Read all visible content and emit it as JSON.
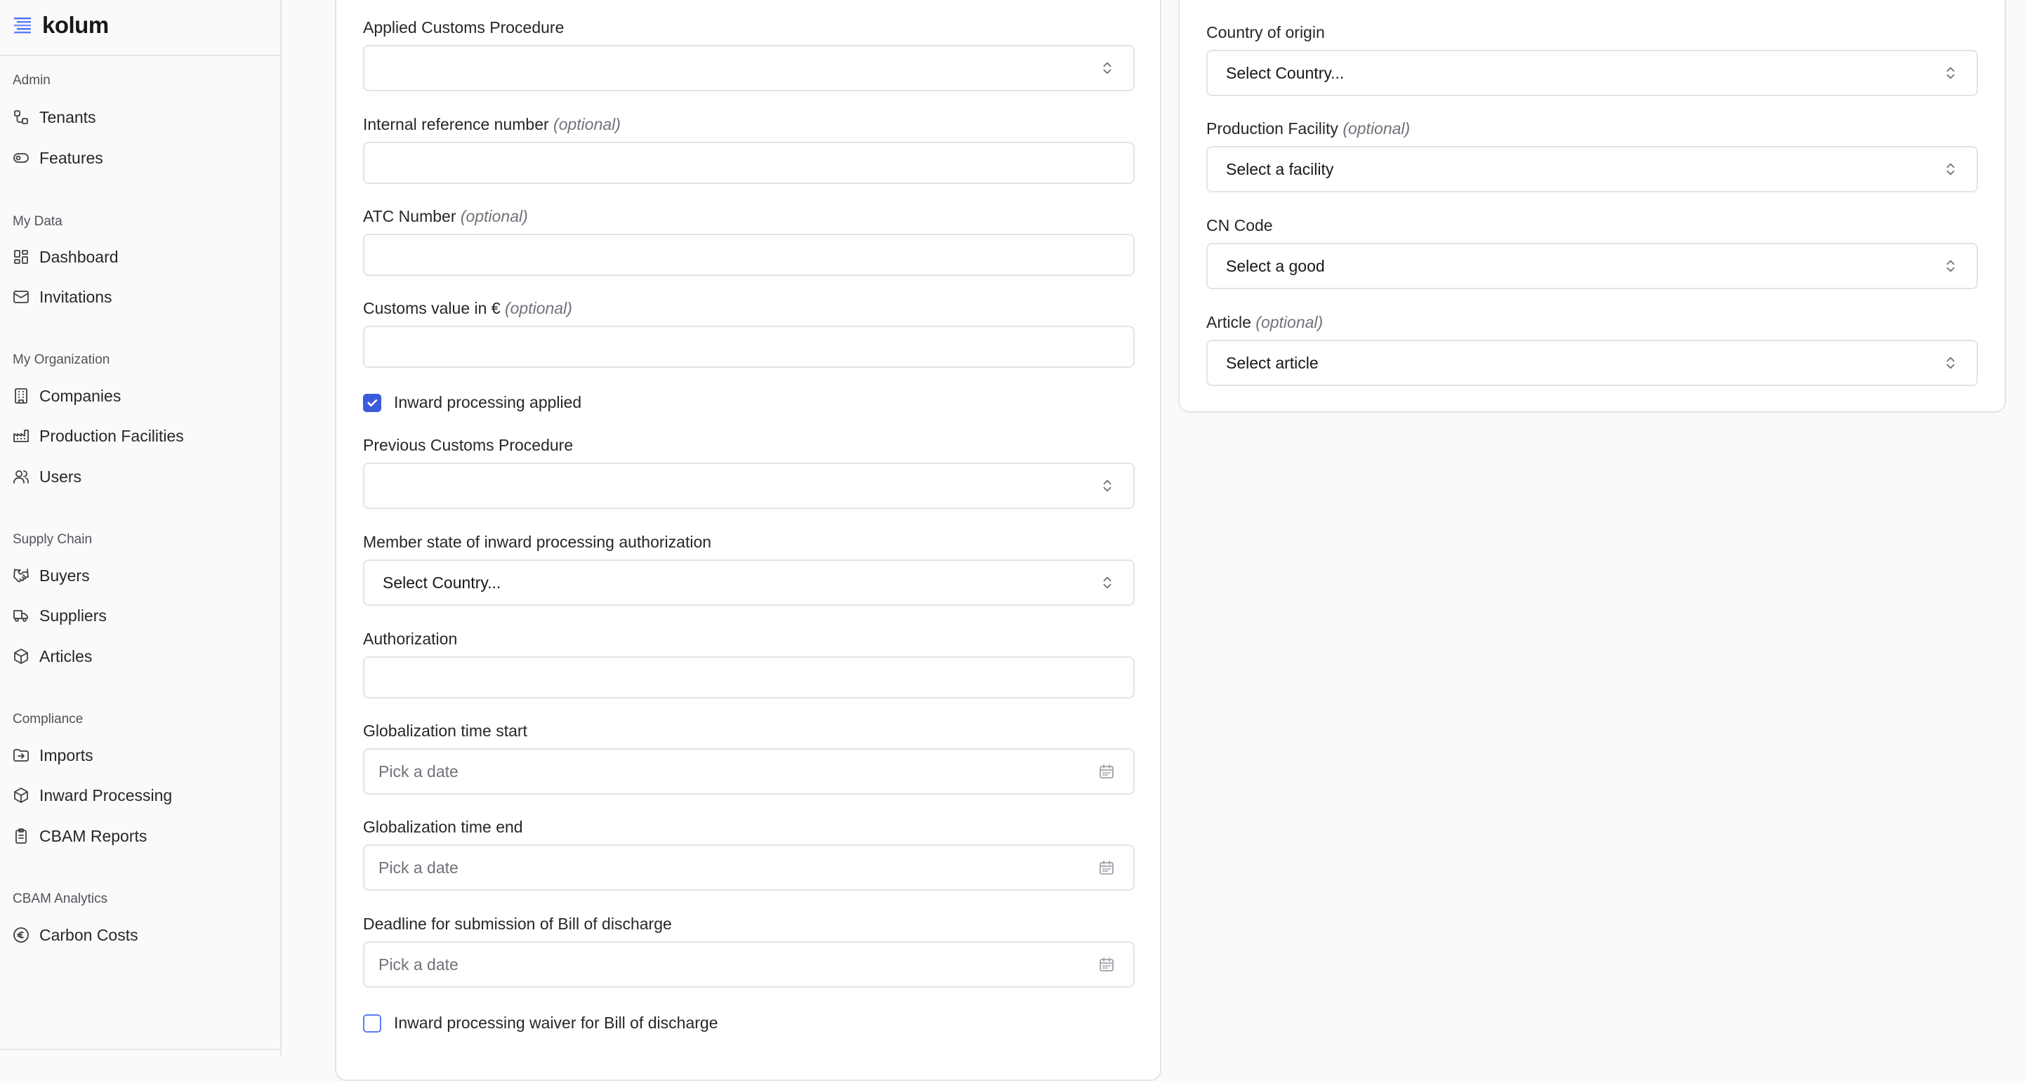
{
  "app": {
    "name": "kolum"
  },
  "sidebar": {
    "sections": [
      {
        "title": "Admin",
        "items": [
          {
            "label": "Tenants",
            "icon": "tenants-icon"
          },
          {
            "label": "Features",
            "icon": "toggle-icon"
          }
        ]
      },
      {
        "title": "My Data",
        "items": [
          {
            "label": "Dashboard",
            "icon": "dashboard-icon"
          },
          {
            "label": "Invitations",
            "icon": "mail-icon"
          }
        ]
      },
      {
        "title": "My Organization",
        "items": [
          {
            "label": "Companies",
            "icon": "building-icon"
          },
          {
            "label": "Production Facilities",
            "icon": "factory-icon"
          },
          {
            "label": "Users",
            "icon": "users-icon"
          }
        ]
      },
      {
        "title": "Supply Chain",
        "items": [
          {
            "label": "Buyers",
            "icon": "handshake-icon"
          },
          {
            "label": "Suppliers",
            "icon": "truck-icon"
          },
          {
            "label": "Articles",
            "icon": "package-icon"
          }
        ]
      },
      {
        "title": "Compliance",
        "items": [
          {
            "label": "Imports",
            "icon": "folder-input-icon"
          },
          {
            "label": "Inward Processing",
            "icon": "package-icon"
          },
          {
            "label": "CBAM Reports",
            "icon": "clipboard-icon"
          }
        ]
      },
      {
        "title": "CBAM Analytics",
        "items": [
          {
            "label": "Carbon Costs",
            "icon": "euro-icon"
          }
        ]
      }
    ]
  },
  "form": {
    "applied_customs_procedure": {
      "label": "Applied Customs Procedure",
      "value": ""
    },
    "internal_reference": {
      "label": "Internal reference number",
      "optional": "(optional)",
      "value": ""
    },
    "atc_number": {
      "label": "ATC Number",
      "optional": "(optional)",
      "value": ""
    },
    "customs_value": {
      "label": "Customs value in €",
      "optional": "(optional)",
      "value": ""
    },
    "inward_processing_applied": {
      "label": "Inward processing applied",
      "checked": true
    },
    "previous_customs_procedure": {
      "label": "Previous Customs Procedure",
      "value": ""
    },
    "member_state": {
      "label": "Member state of inward processing authorization",
      "value": "Select Country..."
    },
    "authorization": {
      "label": "Authorization",
      "value": ""
    },
    "globalization_start": {
      "label": "Globalization time start",
      "placeholder": "Pick a date"
    },
    "globalization_end": {
      "label": "Globalization time end",
      "placeholder": "Pick a date"
    },
    "deadline_bill": {
      "label": "Deadline for submission of Bill of discharge",
      "placeholder": "Pick a date"
    },
    "waiver": {
      "label": "Inward processing waiver for Bill of discharge",
      "checked": false
    }
  },
  "right_form": {
    "country_of_origin": {
      "label": "Country of origin",
      "value": "Select Country..."
    },
    "production_facility": {
      "label": "Production Facility",
      "optional": "(optional)",
      "value": "Select a facility"
    },
    "cn_code": {
      "label": "CN Code",
      "value": "Select a good"
    },
    "article": {
      "label": "Article",
      "optional": "(optional)",
      "value": "Select article"
    }
  },
  "colors": {
    "accent": "#3b5bdb",
    "border": "#e4e4e7",
    "muted": "#71717a"
  }
}
